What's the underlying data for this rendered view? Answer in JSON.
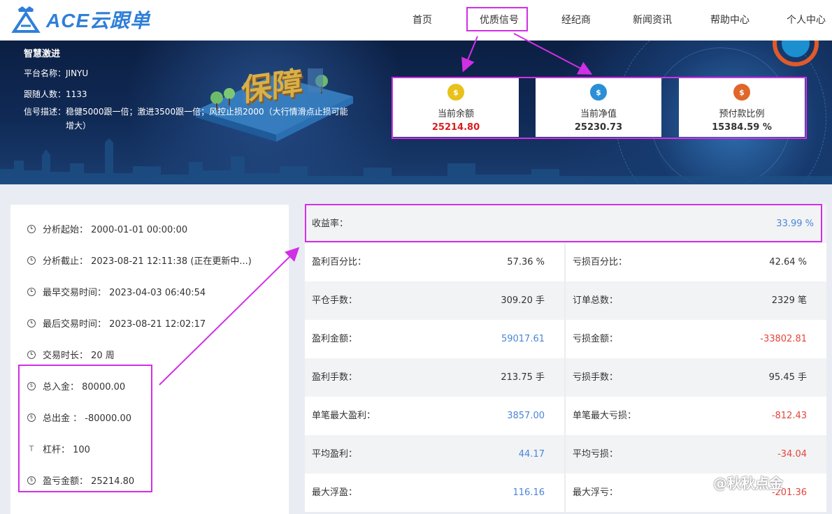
{
  "brand": {
    "name": "ACE云跟单"
  },
  "nav": {
    "items": [
      "首页",
      "优质信号",
      "经纪商",
      "新闻资讯",
      "帮助中心",
      "个人中心"
    ]
  },
  "signal": {
    "name": "智慧激进",
    "platform": "平台名称：JINYU",
    "followers": "跟随人数：1133",
    "desc1": "信号描述：稳健5000跟一倍；激进3500跟一倍；风控止损2000（大行情滑点止损可能",
    "desc2": "增大）",
    "banner_word": "保障"
  },
  "cards": [
    {
      "label": "当前余额",
      "value": "25214.80",
      "color": "#e8c21a",
      "icon": "$"
    },
    {
      "label": "当前净值",
      "value": "25230.73",
      "color": "#2a8fd6",
      "icon": "$"
    },
    {
      "label": "预付款比例",
      "value": "15384.59 %",
      "color": "#e0662a",
      "icon": "$"
    }
  ],
  "left": [
    {
      "icon": "clock-icon",
      "text": "分析起始：  2000-01-01 00:00:00"
    },
    {
      "icon": "clock-icon",
      "text": "分析截止：  2023-08-21 12:11:38    (正在更新中...)"
    },
    {
      "icon": "clock-icon",
      "text": "最早交易时间：  2023-04-03 06:40:54"
    },
    {
      "icon": "clock-icon",
      "text": "最后交易时间：  2023-08-21 12:02:17"
    },
    {
      "icon": "clock-icon",
      "text": "交易时长：  20 周"
    },
    {
      "icon": "coin-icon",
      "text": "总入金：  80000.00"
    },
    {
      "icon": "coin-icon",
      "text": "总出金 ：  -80000.00"
    },
    {
      "icon": "lever-icon",
      "text": "杠杆：  100"
    },
    {
      "icon": "coin-icon",
      "text": "盈亏金额：  25214.80"
    }
  ],
  "stats": {
    "yield_label": "收益率：",
    "yield_value": "33.99 %",
    "rows": [
      {
        "l_label": "盈利百分比：",
        "l_value": "57.36 %",
        "l_color": "dark",
        "r_label": "亏损百分比：",
        "r_value": "42.64 %",
        "r_color": "dark"
      },
      {
        "l_label": "平仓手数：",
        "l_value": "309.20 手",
        "l_color": "dark",
        "r_label": "订单总数：",
        "r_value": "2329 笔",
        "r_color": "dark"
      },
      {
        "l_label": "盈利金额：",
        "l_value": "59017.61",
        "l_color": "blue",
        "r_label": "亏损金额：",
        "r_value": "-33802.81",
        "r_color": "red"
      },
      {
        "l_label": "盈利手数：",
        "l_value": "213.75 手",
        "l_color": "dark",
        "r_label": "亏损手数：",
        "r_value": "95.45 手",
        "r_color": "dark"
      },
      {
        "l_label": "单笔最大盈利：",
        "l_value": "3857.00",
        "l_color": "blue",
        "r_label": "单笔最大亏损：",
        "r_value": "-812.43",
        "r_color": "red"
      },
      {
        "l_label": "平均盈利：",
        "l_value": "44.17",
        "l_color": "blue",
        "r_label": "平均亏损：",
        "r_value": "-34.04",
        "r_color": "red"
      },
      {
        "l_label": "最大浮盈：",
        "l_value": "116.16",
        "l_color": "blue",
        "r_label": "最大浮亏：",
        "r_value": "-201.36",
        "r_color": "red"
      }
    ]
  },
  "watermark": "@秋秋点金"
}
